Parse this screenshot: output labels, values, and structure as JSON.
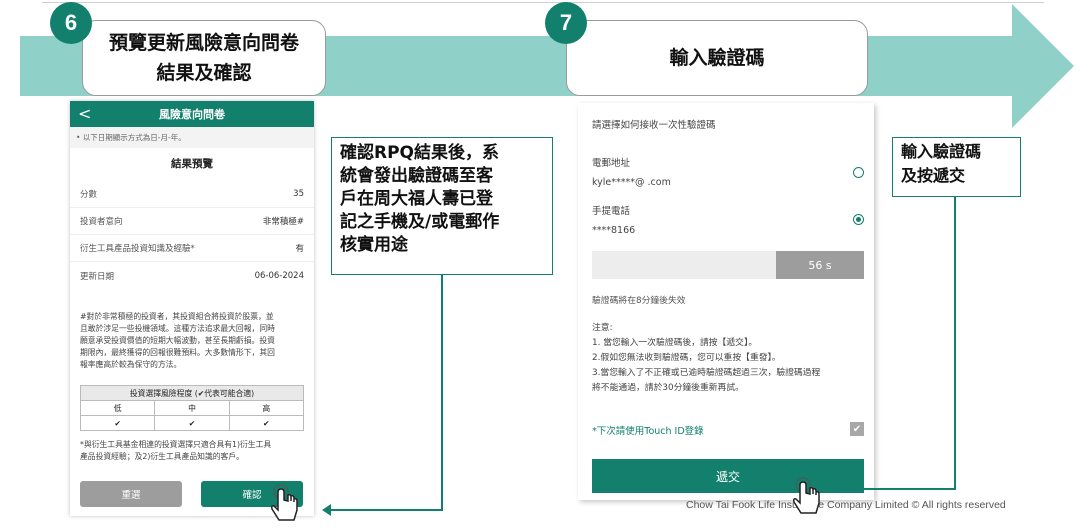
{
  "step6": {
    "number": "6",
    "title_line1": "預覽更新風險意向問卷",
    "title_line2": "結果及確認"
  },
  "step7": {
    "number": "7",
    "title": "輸入驗證碼"
  },
  "phone1": {
    "header_title": "風險意向問卷",
    "back": "<",
    "date_note": "• 以下日期顯示方式為日-月-年。",
    "result_title": "結果預覽",
    "rows": [
      {
        "label": "分數",
        "value": "35"
      },
      {
        "label": "投資者意向",
        "value": "非常積極#"
      },
      {
        "label": "衍生工具產品投資知識及經驗*",
        "value": "有"
      },
      {
        "label": "更新日期",
        "value": "06-06-2024"
      }
    ],
    "paragraph": [
      "#對於非常積極的投資者，其投資組合將投資於股票，並",
      "且敢於涉足一些投機領域。這種方法追求最大回報，同時",
      "願意承受投資價值的短期大幅波動，甚至長期虧損。投資",
      "期限內，最終獲得的回報很難預料。大多數情形下，其回",
      "報率應高於較為保守的方法。"
    ],
    "table": {
      "header": "投資選擇風險程度 (✔代表可能合適)",
      "levels": [
        "低",
        "中",
        "高"
      ],
      "marks": [
        "✔",
        "✔",
        "✔"
      ]
    },
    "footnote_line1": "*與衍生工具基金相連的投資選擇只適合具有1)衍生工具",
    "footnote_line2": "產品投資經驗；及2)衍生工具產品知識的客戶。",
    "btn_back": "重選",
    "btn_confirm": "確認"
  },
  "callout1": {
    "lines": [
      "確認RPQ結果後，系",
      "統會發出驗證碼至客",
      "戶在周大福人壽已登",
      "記之手機及/或電郵作",
      "核實用途"
    ]
  },
  "phone2": {
    "prompt": "請選擇如何接收一次性驗證碼",
    "email_label": "電郵地址",
    "email_value": "kyle*****@          .com",
    "phone_label": "手提電話",
    "phone_value": "****8166",
    "countdown": "56 s",
    "expiry": "驗證碼將在8分鐘後失效",
    "notes_title": "注意:",
    "notes": [
      "1. 當您輸入一次驗證碼後，請按【遞交】。",
      "2.假如您無法收到驗證碼，您可以重按【重發】。",
      "3.當您輸入了不正確或已逾時驗證碼超過三次，驗證碼過程",
      "將不能通過，請於30分鐘後重新再試。"
    ],
    "touch_id": "*下次請使用Touch ID登錄",
    "submit": "遞交"
  },
  "callout2": {
    "lines": [
      "輸入驗證碼",
      "及按遞交"
    ]
  },
  "footer": "Chow Tai Fook Life Insurance Company Limited © All rights reserved",
  "colors": {
    "brand": "#12806c",
    "arrow": "#8fd0c8"
  },
  "icons": [
    "hand-pointer-icon",
    "check-icon",
    "back-chevron-icon",
    "radio-icon"
  ]
}
